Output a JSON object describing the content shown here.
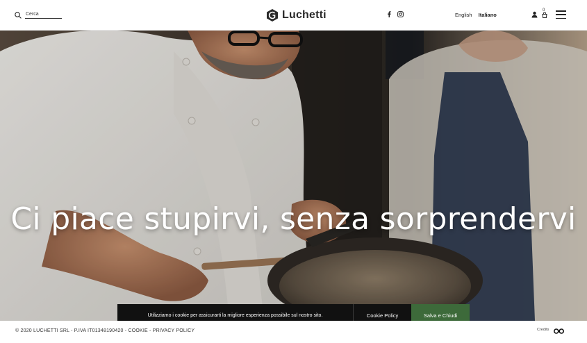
{
  "header": {
    "search_placeholder": "Cerca",
    "search_value": "",
    "logo_text": "Luchetti",
    "social_icons": [
      "facebook-icon",
      "instagram-icon"
    ],
    "languages": [
      {
        "label": "English",
        "active": false
      },
      {
        "label": "Italiano",
        "active": true
      }
    ],
    "cart_count": "0"
  },
  "hero": {
    "title": "Ci piace stupirvi, senza sorprendervi"
  },
  "cookie_banner": {
    "message": "Utilizziamo i cookie per assicurarti la migliore esperienza possibile sul nostro sito.",
    "policy_label": "Cookie Policy",
    "accept_label": "Salva e Chiudi",
    "accept_color": "#3d6a3a"
  },
  "footer": {
    "copyright": "© 2020 LUCHETTI SRL - P.IVA IT01348190420 - COOKIE - PRIVACY POLICY",
    "credits_label": "Credits"
  }
}
